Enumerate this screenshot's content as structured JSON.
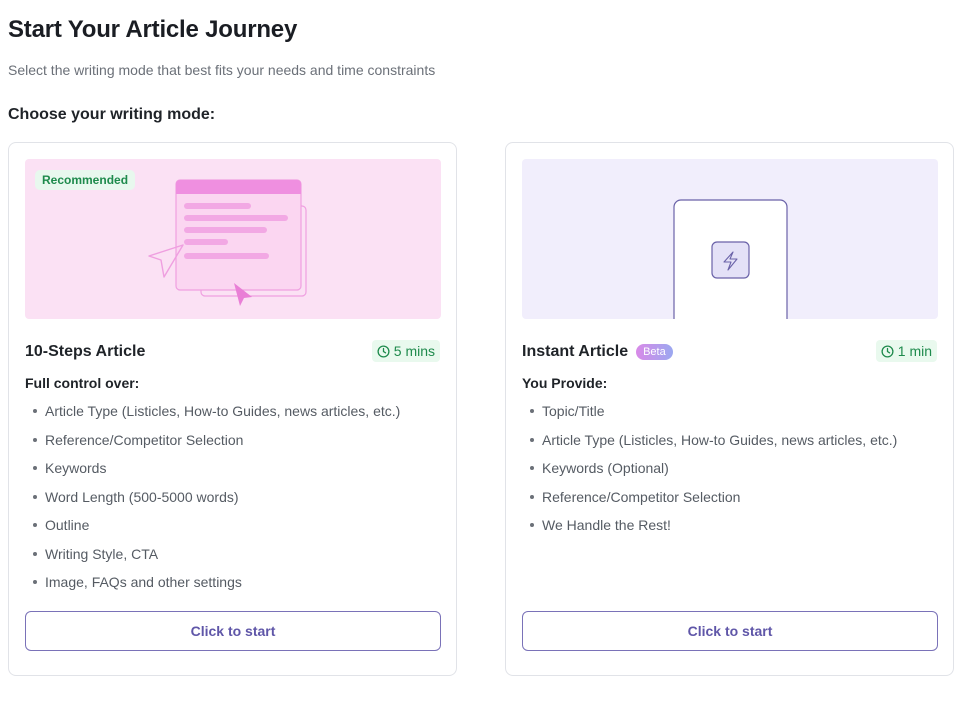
{
  "header": {
    "title": "Start Your Article Journey",
    "subtitle": "Select the writing mode that best fits your needs and time constraints",
    "section_label": "Choose your writing mode:"
  },
  "cards": [
    {
      "badge": "Recommended",
      "title": "10-Steps Article",
      "time": "5 mins",
      "list_heading": "Full control over:",
      "items": [
        "Article Type (Listicles, How-to Guides, news articles, etc.)",
        "Reference/Competitor Selection",
        "Keywords",
        "Word Length (500-5000 words)",
        "Outline",
        "Writing Style, CTA",
        "Image, FAQs and other settings"
      ],
      "button_label": "Click to start"
    },
    {
      "title": "Instant Article",
      "title_badge": "Beta",
      "time": "1 min",
      "list_heading": "You Provide:",
      "items": [
        "Topic/Title",
        "Article Type (Listicles, How-to Guides, news articles, etc.)",
        "Keywords (Optional)",
        "Reference/Competitor Selection",
        "We Handle the Rest!"
      ],
      "button_label": "Click to start"
    }
  ],
  "colors": {
    "accent": "#5f56a8",
    "success": "#1e8a4c",
    "hero_pink": "#fbe1f4",
    "hero_lilac": "#f1eefc"
  },
  "icons": [
    "clock-icon",
    "lightning-icon",
    "cursor-arrow-icon",
    "paper-plane-icon"
  ]
}
